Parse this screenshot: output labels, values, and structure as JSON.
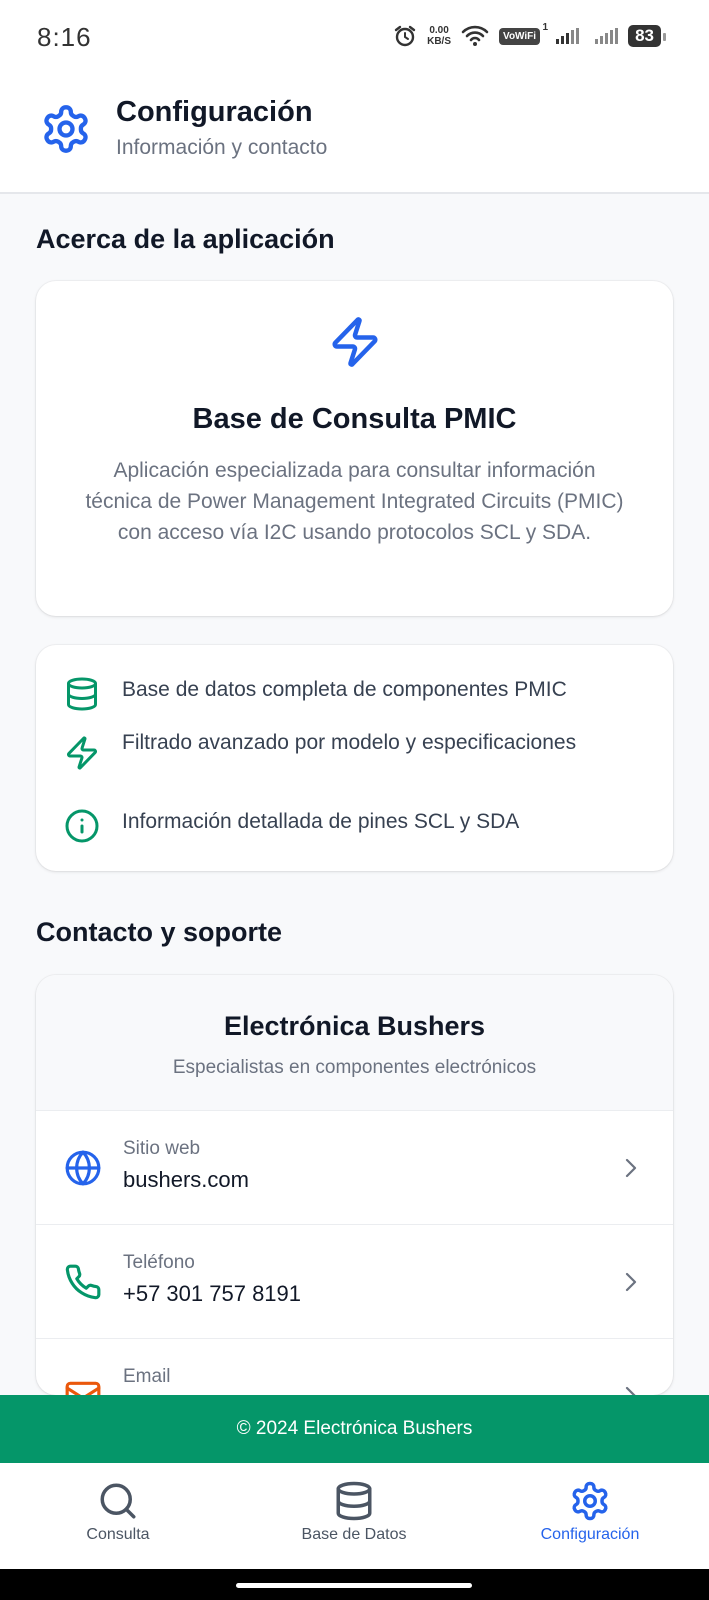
{
  "status_bar": {
    "time": "8:16",
    "speed_value": "0.00",
    "speed_unit": "KB/S",
    "vowifi": "VoWiFi",
    "vowifi_sim": "1",
    "battery": "83"
  },
  "header": {
    "title": "Configuración",
    "subtitle": "Información y contacto",
    "icon": "gear-icon"
  },
  "about": {
    "section_title": "Acerca de la aplicación",
    "icon": "lightning-icon",
    "app_name": "Base de Consulta PMIC",
    "description": "Aplicación especializada para consultar información técnica de Power Management Integrated Circuits (PMIC) con acceso vía I2C usando protocolos SCL y SDA."
  },
  "features": [
    {
      "icon": "database-icon",
      "text": "Base de datos completa de componentes PMIC"
    },
    {
      "icon": "lightning-icon",
      "text": "Filtrado avanzado por modelo y especificaciones"
    },
    {
      "icon": "info-icon",
      "text": "Información detallada de pines SCL y SDA"
    }
  ],
  "contact": {
    "section_title": "Contacto y soporte",
    "company": "Electrónica Bushers",
    "tagline": "Especialistas en componentes electrónicos",
    "items": [
      {
        "icon": "globe-icon",
        "label": "Sitio web",
        "value": "bushers.com"
      },
      {
        "icon": "phone-icon",
        "label": "Teléfono",
        "value": "+57 301 757 8191"
      },
      {
        "icon": "mail-icon",
        "label": "Email",
        "value": ""
      }
    ]
  },
  "footer": {
    "text": "© 2024 Electrónica Bushers"
  },
  "tabs": [
    {
      "icon": "search-icon",
      "label": "Consulta",
      "active": false
    },
    {
      "icon": "database-icon",
      "label": "Base de Datos",
      "active": false
    },
    {
      "icon": "gear-icon",
      "label": "Configuración",
      "active": true
    }
  ],
  "colors": {
    "accent_blue": "#2563eb",
    "accent_green": "#059669",
    "mail_orange": "#ea580c"
  }
}
